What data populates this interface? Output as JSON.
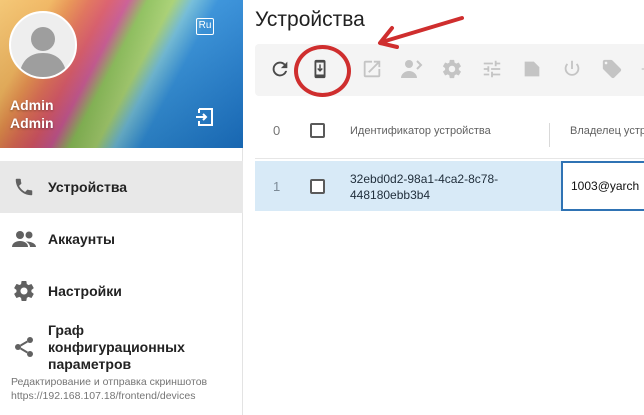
{
  "profile": {
    "first_name": "Admin",
    "last_name": "Admin",
    "lang_label": "Ru",
    "avatar_icon": "user-silhouette-icon",
    "logout_icon": "logout-icon"
  },
  "sidebar": {
    "items": [
      {
        "label": "Устройства",
        "icon": "phone-icon",
        "active": true
      },
      {
        "label": "Аккаунты",
        "icon": "people-icon",
        "active": false
      },
      {
        "label": "Настройки",
        "icon": "gear-icon",
        "active": false
      },
      {
        "label": "Граф конфигурационных параметров",
        "icon": "share-icon",
        "active": false
      }
    ],
    "footer_line1": "Редактирование и отправка скриншотов",
    "footer_line2": "https://192.168.107.18/frontend/devices"
  },
  "main": {
    "title": "Устройства",
    "toolbar": [
      {
        "icon": "refresh-icon",
        "enabled": true
      },
      {
        "icon": "download-device-icon",
        "enabled": true
      },
      {
        "icon": "open-external-icon",
        "enabled": false
      },
      {
        "icon": "assign-user-icon",
        "enabled": false
      },
      {
        "icon": "gear-icon",
        "enabled": false
      },
      {
        "icon": "sliders-icon",
        "enabled": false
      },
      {
        "icon": "folder-icon",
        "enabled": false
      },
      {
        "icon": "power-icon",
        "enabled": false
      },
      {
        "icon": "tag-icon",
        "enabled": false
      }
    ],
    "table": {
      "header_count": "0",
      "columns": [
        "Идентификатор устройства",
        "Владелец устр"
      ],
      "rows": [
        {
          "num": "1",
          "id": "32ebd0d2-98a1-4ca2-8c78-448180ebb3b4",
          "owner": "1003@yarch"
        }
      ]
    }
  },
  "colors": {
    "accent": "#2f73b4",
    "row_selected": "#d8eaf7",
    "annotation": "#cf2e2e",
    "sidebar_active": "#e8e8e8"
  }
}
